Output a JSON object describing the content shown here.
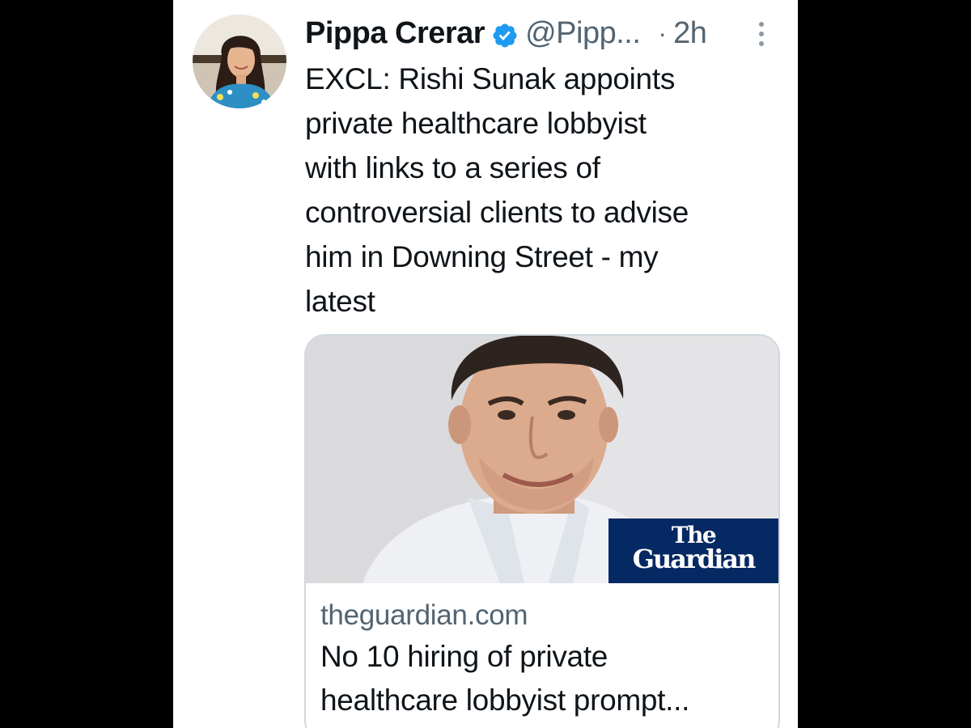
{
  "tweet": {
    "author": {
      "display_name": "Pippa Crerar",
      "handle": "@Pipp...",
      "verified": true,
      "avatar_icon": "profile-photo-avatar"
    },
    "separator": "·",
    "timestamp": "2h",
    "more_icon": "vertical-ellipsis-icon",
    "text": "EXCL: Rishi Sunak appoints\nprivate healthcare lobbyist\nwith links to a series of\ncontroversial clients to advise\nhim in Downing Street - my\nlatest",
    "link_card": {
      "image_icon": "man-portrait-photo",
      "logo": {
        "line1": "The",
        "line2": "Guardian"
      },
      "domain": "theguardian.com",
      "title": "No 10 hiring of private\nhealthcare lobbyist prompt..."
    }
  },
  "colors": {
    "letterbox": "#000000",
    "background": "#ffffff",
    "primary_text": "#0f1419",
    "secondary_text": "#536471",
    "verified_badge": "#1d9bf0",
    "guardian_blue": "#052962",
    "card_border": "#cfd9de"
  }
}
